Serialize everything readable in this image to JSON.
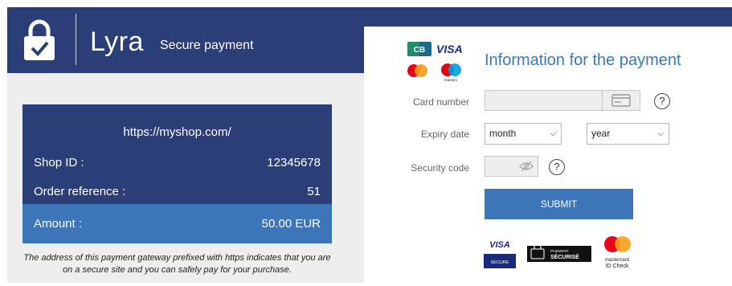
{
  "header": {
    "brand": "Lyra",
    "subtitle": "Secure payment",
    "lock_icon": "lock-check-icon"
  },
  "order": {
    "url": "https://myshop.com/",
    "shop_id_label": "Shop ID :",
    "shop_id_value": "12345678",
    "order_ref_label": "Order reference :",
    "order_ref_value": "51",
    "amount_label": "Amount :",
    "amount_value": "50.00 EUR",
    "note": "The address of this payment gateway prefixed with https indicates that you are on a secure site and you can safely pay for your purchase."
  },
  "form": {
    "title": "Information for the payment",
    "card_number_label": "Card number",
    "card_number_value": "",
    "expiry_label": "Expiry date",
    "month_value": "month",
    "year_value": "year",
    "security_label": "Security code",
    "security_value": "",
    "submit_label": "SUBMIT",
    "help_symbol": "?"
  },
  "logos": {
    "cb_text": "CB",
    "visa_text": "VISA",
    "maestro_text": "maestro"
  },
  "badges": {
    "visa_secure_top": "VISA",
    "visa_secure_bottom": "SECURE",
    "paiement_top": "PAIEMENT",
    "paiement_bottom": "SÉCURISÉ",
    "mc_line1": "mastercard",
    "mc_line2": "ID Check"
  },
  "colors": {
    "navy": "#2c3e78",
    "accent_blue": "#3c75b8",
    "panel_gray": "#eeeeef"
  }
}
